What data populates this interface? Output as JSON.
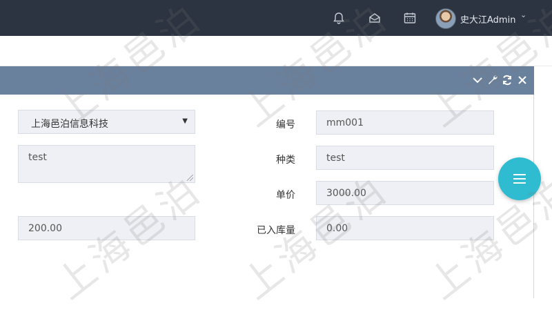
{
  "header": {
    "user_name": "史大江Admin",
    "icons": [
      "bell-icon",
      "inbox-icon",
      "calendar-icon"
    ],
    "caret": "⌄"
  },
  "panel": {
    "tools": [
      "collapse-icon",
      "wrench-icon",
      "refresh-icon",
      "close-icon"
    ],
    "header_color": "#6a819d"
  },
  "form": {
    "company": "上海邑泊信息科技",
    "remark": "test",
    "amount": "200.00",
    "code_label": "编号",
    "code_value": "mm001",
    "category_label": "种类",
    "category_value": "test",
    "price_label": "单价",
    "price_value": "3000.00",
    "stocked_label": "已入库量",
    "stocked_value": "0.00"
  },
  "watermark": "上海邑泊",
  "colors": {
    "accent": "#30bcd0",
    "topbar": "#2b3440"
  }
}
